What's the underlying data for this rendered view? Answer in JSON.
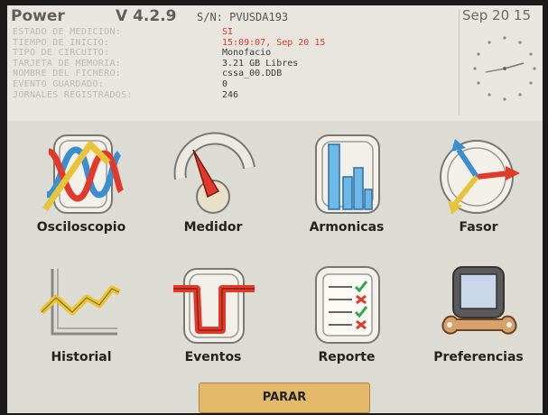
{
  "header": {
    "brand": "Power",
    "version": "V 4.2.9",
    "serial": "S/N: PVUSDA193",
    "date": "Sep 20 15",
    "info_labels": [
      "ESTADO DE MEDICION:",
      "TIEMPO DE INICIO:",
      "TIPO DE CIRCUITO:",
      "TARJETA DE MEMORIA:",
      "NOMBRE DEL FICHERO:",
      "EVENTO GUARDADO:",
      "JORNALES REGISTRADOS:"
    ],
    "info_values": [
      "SI",
      "15:09:07, Sep 20 15",
      "Monofacio",
      "3.21 GB Libres",
      "cssa_00.DDB",
      "0",
      "246"
    ]
  },
  "menu": {
    "items": [
      {
        "label": "Osciloscopio",
        "icon": "oscilloscope-icon"
      },
      {
        "label": "Medidor",
        "icon": "meter-icon"
      },
      {
        "label": "Armonicas",
        "icon": "harmonics-icon"
      },
      {
        "label": "Fasor",
        "icon": "phasor-icon"
      },
      {
        "label": "Historial",
        "icon": "history-icon"
      },
      {
        "label": "Eventos",
        "icon": "events-icon"
      },
      {
        "label": "Reporte",
        "icon": "report-icon"
      },
      {
        "label": "Preferencias",
        "icon": "preferences-icon"
      }
    ]
  },
  "footer": {
    "stop_label": "PARAR"
  },
  "colors": {
    "screen_bg": "#dcdcd4",
    "stop_button": "#e5b96a",
    "accent_red": "#e23a2a",
    "accent_blue": "#3a8fd0",
    "accent_yellow": "#e8c43a"
  }
}
